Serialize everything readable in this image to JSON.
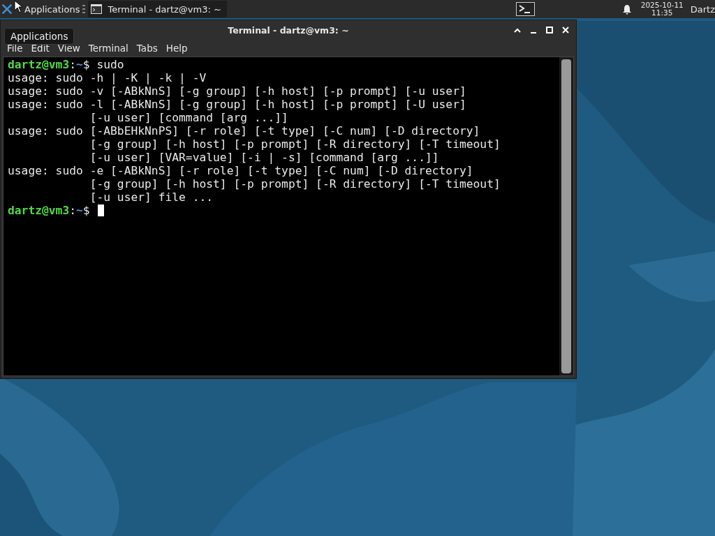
{
  "panel": {
    "applications_menu": {
      "label": "Applications"
    },
    "tasks": [
      {
        "label": "Terminal - dartz@vm3: ~",
        "selected": true
      }
    ],
    "clock": {
      "date": "2025-10-11",
      "time": "11:35"
    },
    "user": "Dartz"
  },
  "tooltip": {
    "text": "Applications"
  },
  "window": {
    "title": "Terminal - dartz@vm3: ~",
    "menu": [
      "File",
      "Edit",
      "View",
      "Terminal",
      "Tabs",
      "Help"
    ],
    "terminal": {
      "lines": [
        {
          "kind": "prompt",
          "user": "dartz@vm3",
          "separator": ":",
          "path": "~",
          "symbol": "$",
          "command": "sudo"
        },
        {
          "kind": "output",
          "text": "usage: sudo -h | -K | -k | -V"
        },
        {
          "kind": "output",
          "text": "usage: sudo -v [-ABkNnS] [-g group] [-h host] [-p prompt] [-u user]"
        },
        {
          "kind": "output",
          "text": "usage: sudo -l [-ABkNnS] [-g group] [-h host] [-p prompt] [-U user]"
        },
        {
          "kind": "output",
          "text": "            [-u user] [command [arg ...]]"
        },
        {
          "kind": "output",
          "text": "usage: sudo [-ABbEHkNnPS] [-r role] [-t type] [-C num] [-D directory]"
        },
        {
          "kind": "output",
          "text": "            [-g group] [-h host] [-p prompt] [-R directory] [-T timeout]"
        },
        {
          "kind": "output",
          "text": "            [-u user] [VAR=value] [-i | -s] [command [arg ...]]"
        },
        {
          "kind": "output",
          "text": "usage: sudo -e [-ABkNnS] [-r role] [-t type] [-C num] [-D directory]"
        },
        {
          "kind": "output",
          "text": "            [-g group] [-h host] [-p prompt] [-R directory] [-T timeout]"
        },
        {
          "kind": "output",
          "text": "            [-u user] file ..."
        },
        {
          "kind": "prompt",
          "user": "dartz@vm3",
          "separator": ":",
          "path": "~",
          "symbol": "$",
          "cursor": true
        }
      ]
    }
  }
}
